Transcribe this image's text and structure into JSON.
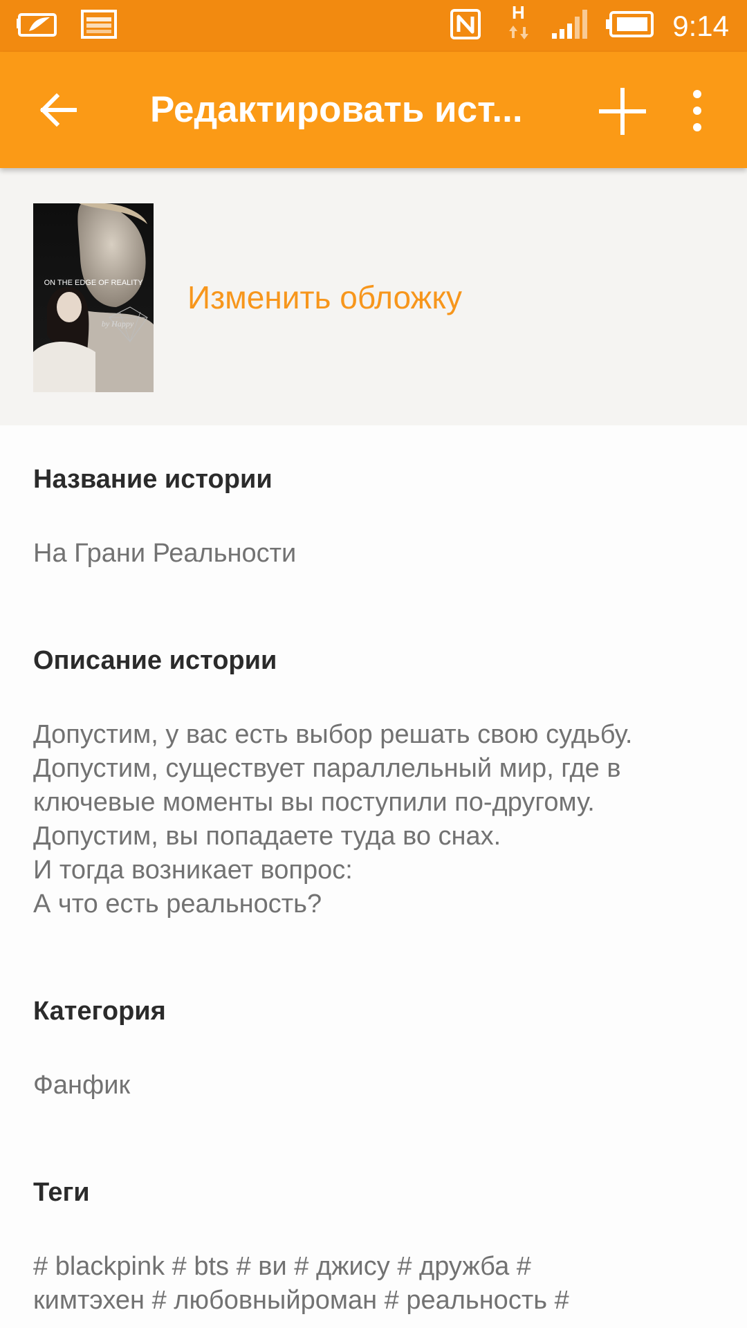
{
  "status_bar": {
    "time": "9:14",
    "left_icons": [
      "gallery-notification-icon",
      "image-notification-icon"
    ],
    "right_icons": [
      "nfc-icon",
      "network-h-icon",
      "signal-icon",
      "battery-icon"
    ]
  },
  "toolbar": {
    "title": "Редактировать ист...",
    "back_icon": "arrow-back-icon",
    "add_icon": "plus-icon",
    "more_icon": "more-vert-icon"
  },
  "cover": {
    "change_cover_label": "Изменить обложку",
    "thumbnail_title": "ON THE EDGE OF REALITY",
    "thumbnail_author": "by Happy"
  },
  "story": {
    "title_label": "Название истории",
    "title_value": "На Грани Реальности",
    "description_label": "Описание истории",
    "description_lines": [
      "Допустим, у вас есть выбор решать свою судьбу.",
      "Допустим, существует параллельный мир, где в",
      "ключевые моменты вы поступили по-другому.",
      "Допустим, вы попадаете туда во снах.",
      "И тогда возникает вопрос:",
      "А что есть реальность?"
    ],
    "category_label": "Категория",
    "category_value": "Фанфик",
    "tags_label": "Теги",
    "tags_lines": [
      "# blackpink # bts # ви # джису # дружба #",
      "кимтэхен # любовныйроман # реальность #"
    ]
  },
  "colors": {
    "status_bar": "#f28a10",
    "toolbar": "#fb9a16",
    "accent": "#f7961c",
    "cover_bg": "#f5f4f2"
  }
}
